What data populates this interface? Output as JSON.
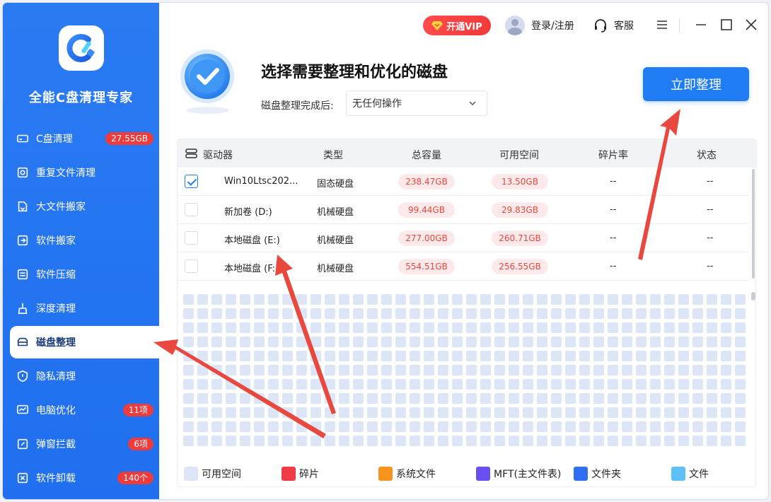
{
  "app": {
    "title": "全能C盘清理专家"
  },
  "sidebar": {
    "items": [
      {
        "label": "C盘清理",
        "badge": "27.55GB",
        "icon": "drive-icon"
      },
      {
        "label": "重复文件清理",
        "badge": "",
        "icon": "duplicate-icon"
      },
      {
        "label": "大文件搬家",
        "badge": "",
        "icon": "move-file-icon"
      },
      {
        "label": "软件搬家",
        "badge": "",
        "icon": "move-app-icon"
      },
      {
        "label": "软件压缩",
        "badge": "",
        "icon": "compress-icon"
      },
      {
        "label": "深度清理",
        "badge": "",
        "icon": "brush-icon"
      },
      {
        "label": "磁盘整理",
        "badge": "",
        "icon": "disk-icon",
        "active": true
      },
      {
        "label": "隐私清理",
        "badge": "",
        "icon": "shield-icon"
      },
      {
        "label": "电脑优化",
        "badge": "11项",
        "icon": "monitor-icon"
      },
      {
        "label": "弹窗拦截",
        "badge": "6项",
        "icon": "popup-icon"
      },
      {
        "label": "软件卸载",
        "badge": "140个",
        "icon": "uninstall-icon"
      }
    ]
  },
  "topbar": {
    "vip_label": "开通VIP",
    "login_label": "登录/注册",
    "service_label": "客服"
  },
  "header": {
    "title": "选择需要整理和优化的磁盘",
    "after_label": "磁盘整理完成后:",
    "after_value": "无任何操作",
    "start_button": "立即整理"
  },
  "table": {
    "headers": [
      "驱动器",
      "类型",
      "总容量",
      "可用空间",
      "碎片率",
      "状态"
    ],
    "rows": [
      {
        "checked": true,
        "name": "Win10Ltsc202...",
        "type": "固态硬盘",
        "total": "238.47GB",
        "free": "13.50GB",
        "frag": "--",
        "status": "--"
      },
      {
        "checked": false,
        "name": "新加卷 (D:)",
        "type": "机械硬盘",
        "total": "99.44GB",
        "free": "29.83GB",
        "frag": "--",
        "status": "--"
      },
      {
        "checked": false,
        "name": "本地磁盘 (E:)",
        "type": "机械硬盘",
        "total": "277.00GB",
        "free": "260.71GB",
        "frag": "--",
        "status": "--"
      },
      {
        "checked": false,
        "name": "本地磁盘 (F:)",
        "type": "机械硬盘",
        "total": "554.51GB",
        "free": "256.55GB",
        "frag": "--",
        "status": "--"
      }
    ]
  },
  "legend": [
    {
      "label": "可用空间",
      "color": "#dde6f7"
    },
    {
      "label": "碎片",
      "color": "#ee3b44"
    },
    {
      "label": "系统文件",
      "color": "#f7931e"
    },
    {
      "label": "MFT(主文件表)",
      "color": "#6b4ef0"
    },
    {
      "label": "文件夹",
      "color": "#2f6ff2"
    },
    {
      "label": "文件",
      "color": "#5ec0f7"
    }
  ],
  "colors": {
    "accent": "#1f7cf2",
    "sidebar": "#2a7bf2",
    "badge": "#ee3b3b",
    "annotation_arrow": "#e9483f"
  }
}
